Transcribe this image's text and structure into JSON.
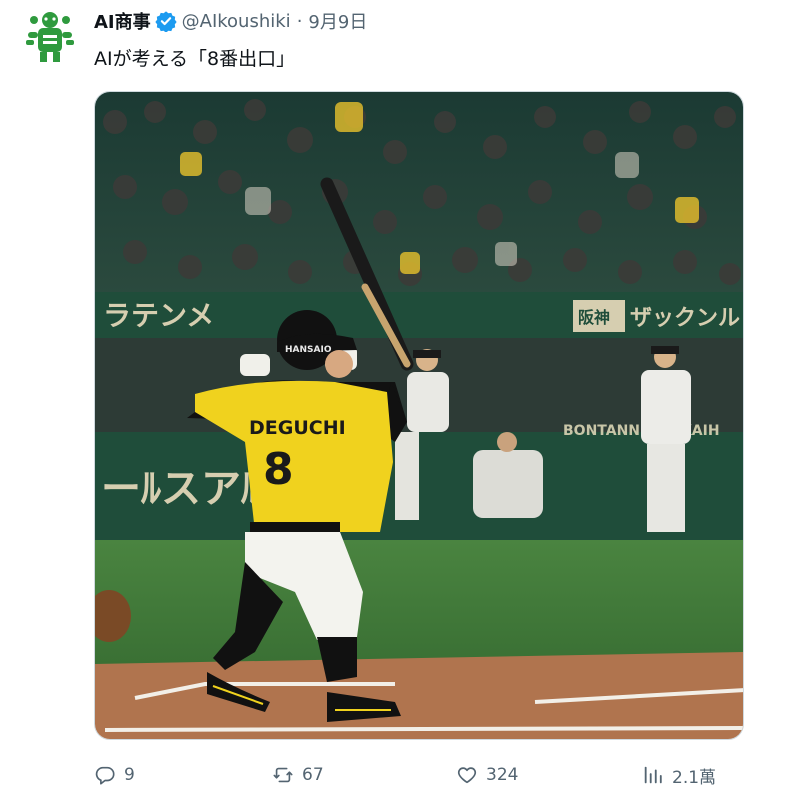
{
  "tweet": {
    "author_name": "AI商事",
    "handle": "@AIkoushiki",
    "separator": "·",
    "date": "9月9日",
    "text": "AIが考える「8番出口」"
  },
  "image": {
    "banner_left_text": "ラテンメ",
    "banner_right_logo": "阪神",
    "banner_right_text": "ザックンル",
    "wall_left_text": "ーﾙスアﾙ",
    "wall_right_text": "BONTANNENSEKAIH",
    "helmet_text": "HANSAIO",
    "jersey_name": "DEGUCHI",
    "jersey_number": "8",
    "colors": {
      "jersey": "#f0d21e",
      "turf": "#3f7a3a",
      "dirt": "#b0744e",
      "wall": "#1f4d3a"
    }
  },
  "actions": {
    "replies": "9",
    "retweets": "67",
    "likes": "324",
    "views": "2.1萬"
  },
  "icons": [
    "avatar-mascot-icon",
    "verified-badge-icon",
    "reply-icon",
    "retweet-icon",
    "like-icon",
    "views-icon"
  ]
}
